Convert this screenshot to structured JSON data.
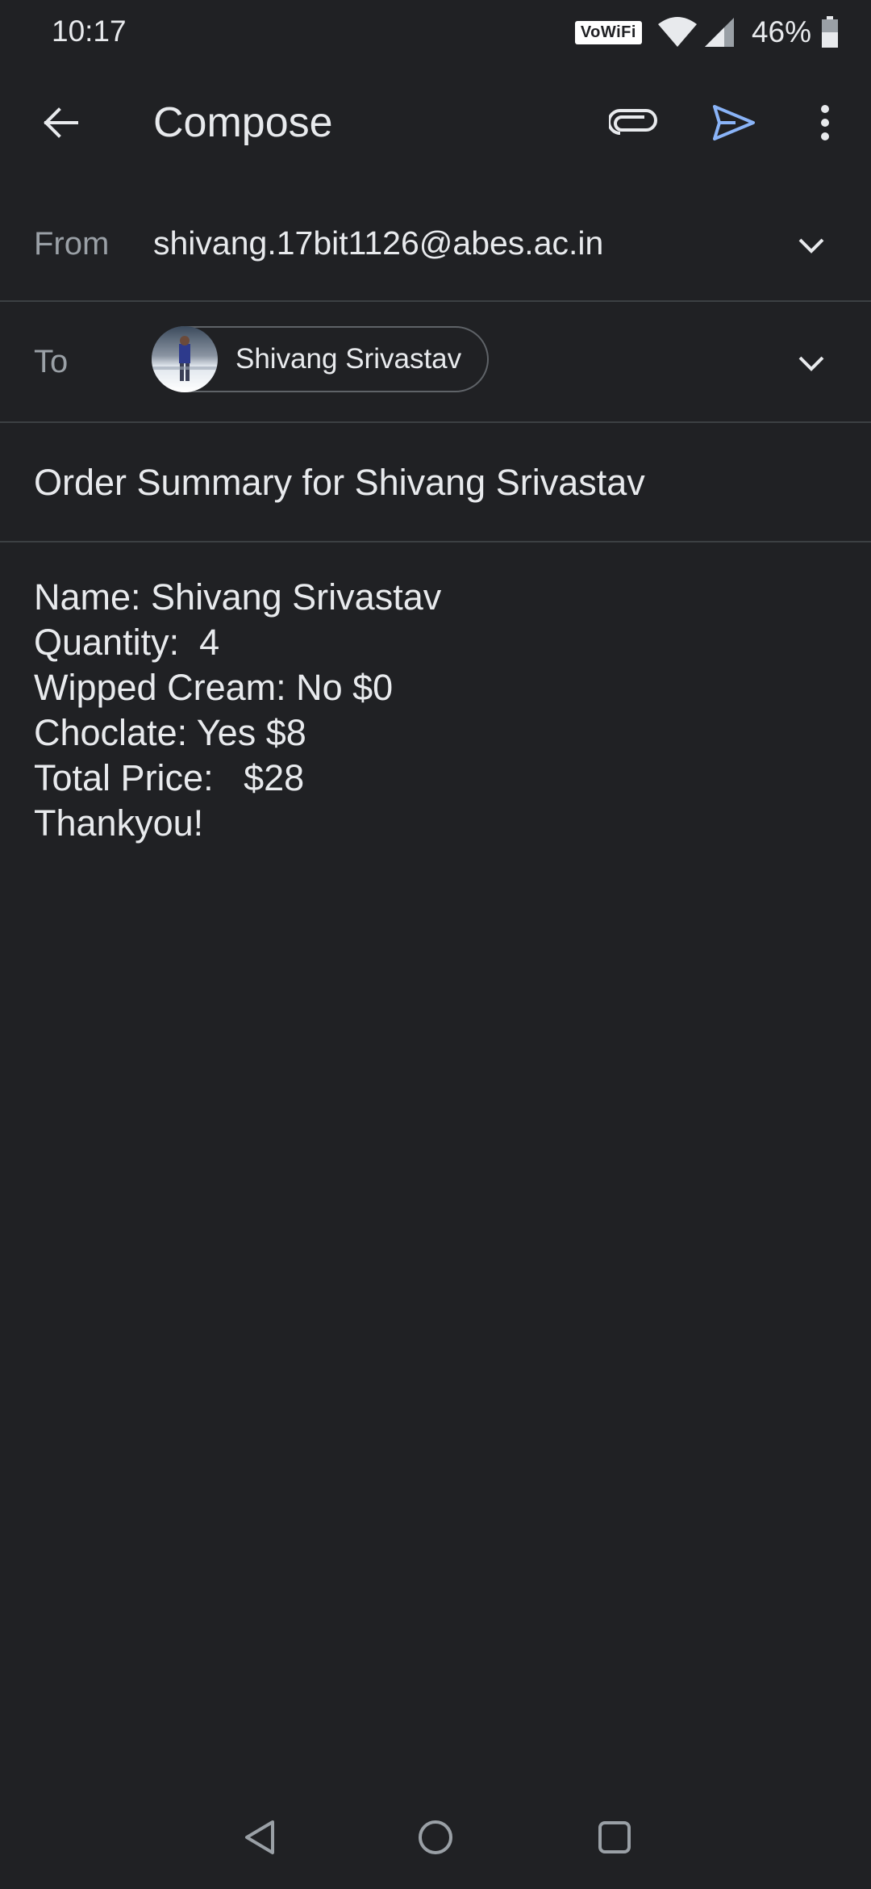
{
  "status_bar": {
    "time": "10:17",
    "vowifi_label": "VoWiFi",
    "battery_percent": "46%",
    "battery_level": 0.46
  },
  "app_bar": {
    "title": "Compose",
    "icons": [
      "back-arrow-icon",
      "paperclip-icon",
      "send-icon",
      "more-vertical-icon"
    ],
    "send_color": "#8ab4f8"
  },
  "from": {
    "label": "From",
    "value": "shivang.17bit1126@abes.ac.in"
  },
  "to": {
    "label": "To",
    "recipient_name": "Shivang Srivastav"
  },
  "subject": "Order Summary for Shivang Srivastav",
  "body": {
    "lines": [
      "Name: Shivang Srivastav",
      "Quantity:  4",
      "Wipped Cream: No $0",
      "Choclate: Yes $8",
      "Total Price:   $28",
      "Thankyou!"
    ]
  },
  "nav_bar": {
    "icons": [
      "nav-back-icon",
      "nav-home-icon",
      "nav-recents-icon"
    ]
  },
  "colors": {
    "background": "#202124",
    "text": "#e8eaed",
    "secondary_text": "#9aa0a6",
    "divider": "#3c4043",
    "accent": "#8ab4f8"
  }
}
